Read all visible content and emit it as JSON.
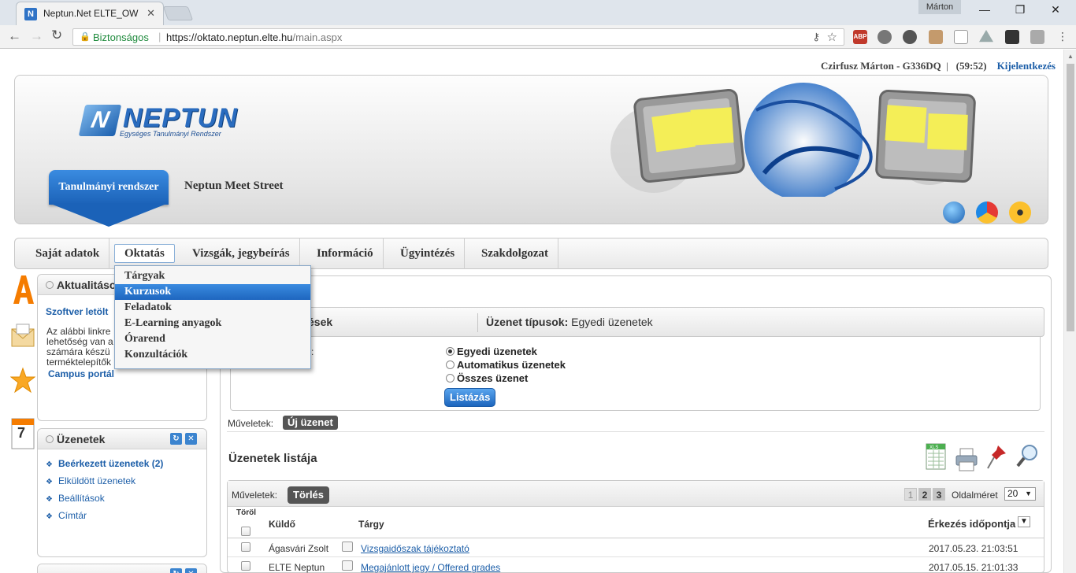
{
  "browser": {
    "tab_title": "Neptun.Net ELTE_OW",
    "tab_favicon": "N",
    "user_badge": "Márton",
    "security_label": "Biztonságos",
    "url_host": "https://oktato.neptun.elte.hu",
    "url_path": "/main.aspx",
    "extensions": [
      "ABP",
      "globe",
      "sync",
      "person",
      "doc",
      "drive",
      "cat",
      "puzzle"
    ]
  },
  "header": {
    "user_name": "Czirfusz Márton - G336DQ",
    "sep": "|",
    "timer": "(59:52)",
    "logout": "Kijelentkezés",
    "logo_word": "NEPTUN",
    "logo_subtitle": "Egységes Tanulmányi Rendszer",
    "system_tab": "Tanulmányi rendszer",
    "meet_street": "Neptun Meet Street"
  },
  "menu": {
    "items": [
      "Saját adatok",
      "Oktatás",
      "Vizsgák, jegybeírás",
      "Információ",
      "Ügyintézés",
      "Szakdolgozat"
    ],
    "active": "Oktatás",
    "dropdown": [
      "Tárgyak",
      "Kurzusok",
      "Feladatok",
      "E-Learning anyagok",
      "Órarend",
      "Konzultációk"
    ],
    "dropdown_selected": "Kurzusok"
  },
  "news_panel": {
    "title": "Aktualitáso",
    "link": "Szoftver letölt",
    "text_lines": [
      "Az alábbi linkre",
      "lehetőség van a",
      "számára készü",
      "terméktelepítők"
    ],
    "campus_link": "Campus portál"
  },
  "messages_panel": {
    "title": "Üzenetek",
    "links": [
      "Beérkezett üzenetek (2)",
      "Elküldött üzenetek",
      "Beállítások",
      "Címtár"
    ]
  },
  "filter": {
    "head_left": "zűrések",
    "head_right_label": "Üzenet típusok:",
    "head_right_value": "Egyedi üzenetek",
    "colon": ":",
    "options": [
      "Egyedi üzenetek",
      "Automatikus üzenetek",
      "Összes üzenet"
    ],
    "selected_index": 0,
    "list_button": "Listázás"
  },
  "actions": {
    "label": "Műveletek:",
    "new_message": "Új üzenet",
    "delete": "Törlés"
  },
  "list": {
    "title": "Üzenetek listája",
    "pages": [
      "1",
      "2",
      "3"
    ],
    "current_page": "1",
    "page_size_label": "Oldalméret",
    "page_size": "20",
    "columns": {
      "delete": "Töröl",
      "sender": "Küldő",
      "subject": "Tárgy",
      "received": "Érkezés időpontja"
    },
    "rows": [
      {
        "sender": "Ágasvári Zsolt",
        "subject": "Vizsgaidőszak tájékoztató",
        "received": "2017.05.23. 21:03:51"
      },
      {
        "sender": "ELTE Neptun",
        "subject": "Megajánlott jegy / Offered grades",
        "received": "2017.05.15. 21:01:33"
      }
    ]
  }
}
